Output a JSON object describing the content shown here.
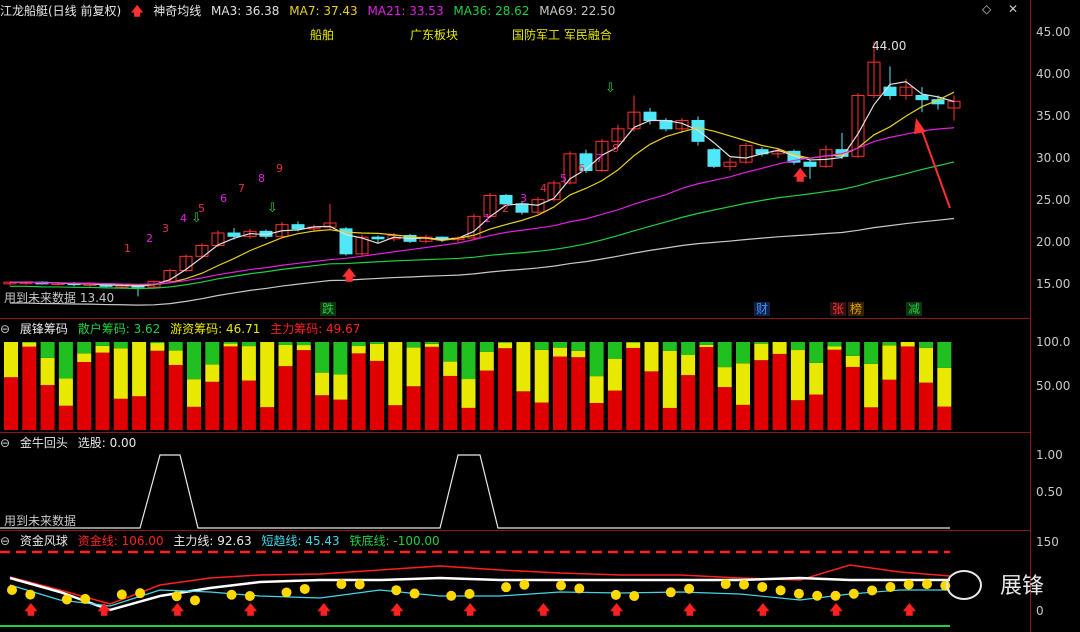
{
  "main": {
    "title": "江龙船艇(日线 前复权)",
    "indicator_name": "神奇均线",
    "ma_values": [
      {
        "label": "MA3: 36.38",
        "color": "#e0e0e0"
      },
      {
        "label": "MA7: 37.43",
        "color": "#e8d020"
      },
      {
        "label": "MA21: 33.53",
        "color": "#e020e0"
      },
      {
        "label": "MA36: 28.62",
        "color": "#20d040"
      },
      {
        "label": "MA69: 22.50",
        "color": "#c8c8c8"
      }
    ],
    "sectors": [
      "船舶",
      "广东板块",
      "国防军工 军民融合"
    ],
    "y_ticks": [
      "45.00",
      "40.00",
      "35.00",
      "30.00",
      "25.00",
      "20.00",
      "15.00"
    ],
    "high_label": "44.00",
    "low_label": "用到未来数据  13.40",
    "event_tags": [
      {
        "text": "跌",
        "color": "#20d040"
      },
      {
        "text": "财",
        "color": "#2080ff"
      },
      {
        "text": "张",
        "color": "#ff3030"
      },
      {
        "text": "榜",
        "color": "#e0a000"
      },
      {
        "text": "减",
        "color": "#20d040"
      }
    ],
    "seq_labels": [
      "1",
      "2",
      "3",
      "4",
      "5",
      "6",
      "7",
      "8",
      "9",
      "1",
      "2",
      "3",
      "4",
      "5",
      "6",
      "7",
      "8",
      "9"
    ]
  },
  "chip": {
    "name": "展锋筹码",
    "retail_label": "散户筹码: 3.62",
    "hot_label": "游资筹码: 46.71",
    "main_label": "主力筹码: 49.67",
    "y_ticks": [
      "100.0",
      "50.00"
    ]
  },
  "golden": {
    "name": "金牛回头",
    "pick_label": "选股: 0.00",
    "future_label": "用到未来数据",
    "y_ticks": [
      "1.00",
      "0.50"
    ]
  },
  "fund": {
    "name": "资金风球",
    "fund_line": "资金线: 106.00",
    "main_line": "主力线: 92.63",
    "short_line": "短趋线: 45.43",
    "bottom_line": "铁底线: -100.00",
    "y_ticks": [
      "150",
      "0"
    ]
  },
  "watermark": "展锋",
  "colors": {
    "up": "#ff3030",
    "down": "#50e8f8",
    "border": "#8a1a1a",
    "yellow": "#e8e800",
    "green": "#20c020",
    "red": "#e00000"
  }
}
